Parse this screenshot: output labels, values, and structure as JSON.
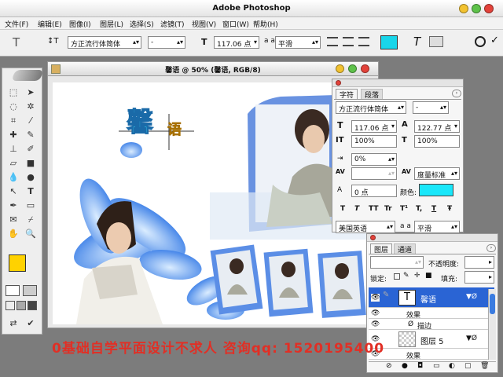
{
  "app": {
    "title": "Adobe Photoshop"
  },
  "menu": [
    "文件(F)",
    "编辑(E)",
    "图像(I)",
    "图层(L)",
    "选择(S)",
    "滤镜(T)",
    "视图(V)",
    "窗口(W)",
    "帮助(H)"
  ],
  "options": {
    "tool_glyph": "T",
    "font_family": "方正流行体简体",
    "font_style": "-",
    "size_prefix": "T",
    "font_size": "117.06 点",
    "aa_prefix": "a a",
    "antialias": "平滑",
    "swatch_color": "#19d6ea"
  },
  "document": {
    "title": "馨语 @ 50% (馨语, RGB/8)",
    "heading_glyph_1": "馨",
    "heading_glyph_2": "语"
  },
  "character_panel": {
    "tabs": [
      "字符",
      "段落"
    ],
    "font_family": "方正流行体简体",
    "font_style": "-",
    "size": "117.06 点",
    "leading": "122.77 点",
    "vscale": "100%",
    "hscale": "100%",
    "tsume": "0%",
    "kerning": "度量标准",
    "baseline_label": "A",
    "baseline": "0 点",
    "color_label": "颜色:",
    "color": "#19e7fa",
    "style_buttons": [
      "T",
      "T",
      "TT",
      "Tr",
      "T¹",
      "T,",
      "T",
      "Ŧ"
    ],
    "language": "美国英语",
    "antialias": "平滑"
  },
  "layers_panel": {
    "tabs": [
      "图层",
      "通道"
    ],
    "opacity_label": "不透明度:",
    "lock_label": "锁定:",
    "fill_label": "填充:",
    "layers": [
      {
        "name": "馨语",
        "selected": true,
        "type": "text"
      },
      {
        "name": "效果",
        "sub": true
      },
      {
        "name": "描边",
        "sub": true
      },
      {
        "name": "图层 5",
        "selected": false,
        "type": "image"
      },
      {
        "name": "效果",
        "sub": true
      }
    ]
  },
  "watermark": "0基础自学平面设计不求人 咨询qq: 1520195400"
}
